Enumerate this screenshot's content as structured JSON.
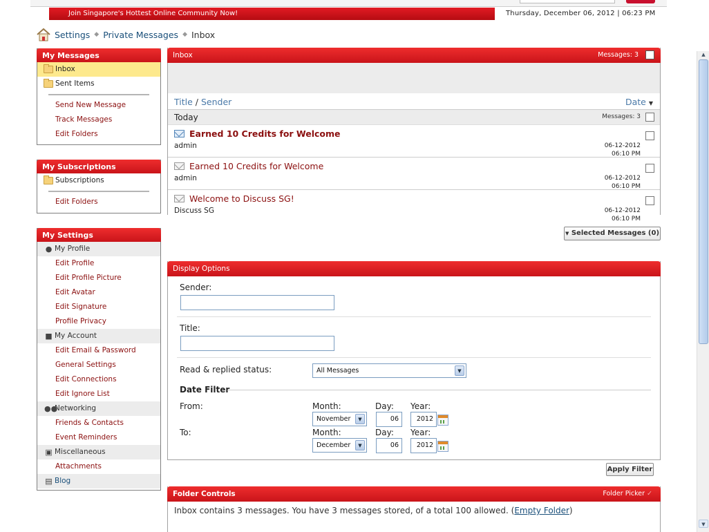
{
  "banner": {
    "text": "Join Singapore's Hottest Online Community Now!"
  },
  "datetime": "Thursday, December 06, 2012 | 06:23 PM",
  "breadcrumb": {
    "items": [
      "Settings",
      "Private Messages",
      "Inbox"
    ]
  },
  "my_messages": {
    "title": "My Messages",
    "folders": [
      "Inbox",
      "Sent Items"
    ],
    "links": [
      "Send New Message",
      "Track Messages",
      "Edit Folders"
    ]
  },
  "my_subscriptions": {
    "title": "My Subscriptions",
    "folders": [
      "Subscriptions"
    ],
    "links": [
      "Edit Folders"
    ]
  },
  "my_settings": {
    "title": "My Settings",
    "groups": [
      {
        "label": "My Profile",
        "icon": "user-icon",
        "items": [
          "Edit Profile",
          "Edit Profile Picture",
          "Edit Avatar",
          "Edit Signature",
          "Profile Privacy"
        ]
      },
      {
        "label": "My Account",
        "icon": "lock-icon",
        "items": [
          "Edit Email & Password",
          "General Settings",
          "Edit Connections",
          "Edit Ignore List"
        ]
      },
      {
        "label": "Networking",
        "icon": "people-icon",
        "items": [
          "Friends & Contacts",
          "Event Reminders"
        ]
      },
      {
        "label": "Miscellaneous",
        "icon": "misc-icon",
        "items": [
          "Attachments"
        ]
      },
      {
        "label": "Blog",
        "icon": "blog-icon",
        "items": []
      }
    ]
  },
  "inbox": {
    "title": "Inbox",
    "count_label": "Messages: 3",
    "col_title": "Title",
    "col_sep": "/",
    "col_sender": "Sender",
    "col_date": "Date",
    "group_label": "Today",
    "group_count": "Messages: 3",
    "messages": [
      {
        "title": "Earned 10 Credits for Welcome",
        "sender": "admin",
        "date": "06-12-2012",
        "time": "06:10 PM",
        "unread": true
      },
      {
        "title": "Earned 10 Credits for Welcome",
        "sender": "admin",
        "date": "06-12-2012",
        "time": "06:10 PM",
        "unread": false
      },
      {
        "title": "Welcome to Discuss SG!",
        "sender": "Discuss SG",
        "date": "06-12-2012",
        "time": "06:10 PM",
        "unread": false
      }
    ],
    "selected_button": "Selected Messages (0)"
  },
  "display_options": {
    "title": "Display Options",
    "sender_label": "Sender:",
    "sender_value": "",
    "title_label": "Title:",
    "title_value": "",
    "status_label": "Read & replied status:",
    "status_value": "All Messages",
    "date_filter_title": "Date Filter",
    "from_label": "From:",
    "to_label": "To:",
    "month_label": "Month:",
    "day_label": "Day:",
    "year_label": "Year:",
    "from_month": "November",
    "from_day": "06",
    "from_year": "2012",
    "to_month": "December",
    "to_day": "06",
    "to_year": "2012",
    "apply_button": "Apply Filter"
  },
  "folder_controls": {
    "title": "Folder Controls",
    "picker_label": "Folder Picker",
    "info_text": "Inbox contains 3 messages. You have 3 messages stored, of a total 100 allowed. (",
    "empty_link": "Empty Folder",
    "info_end": ")"
  },
  "colors": {
    "accent_red": "#d71920",
    "link_blue": "#1a4f7a",
    "selected_yellow": "#fde98d"
  }
}
